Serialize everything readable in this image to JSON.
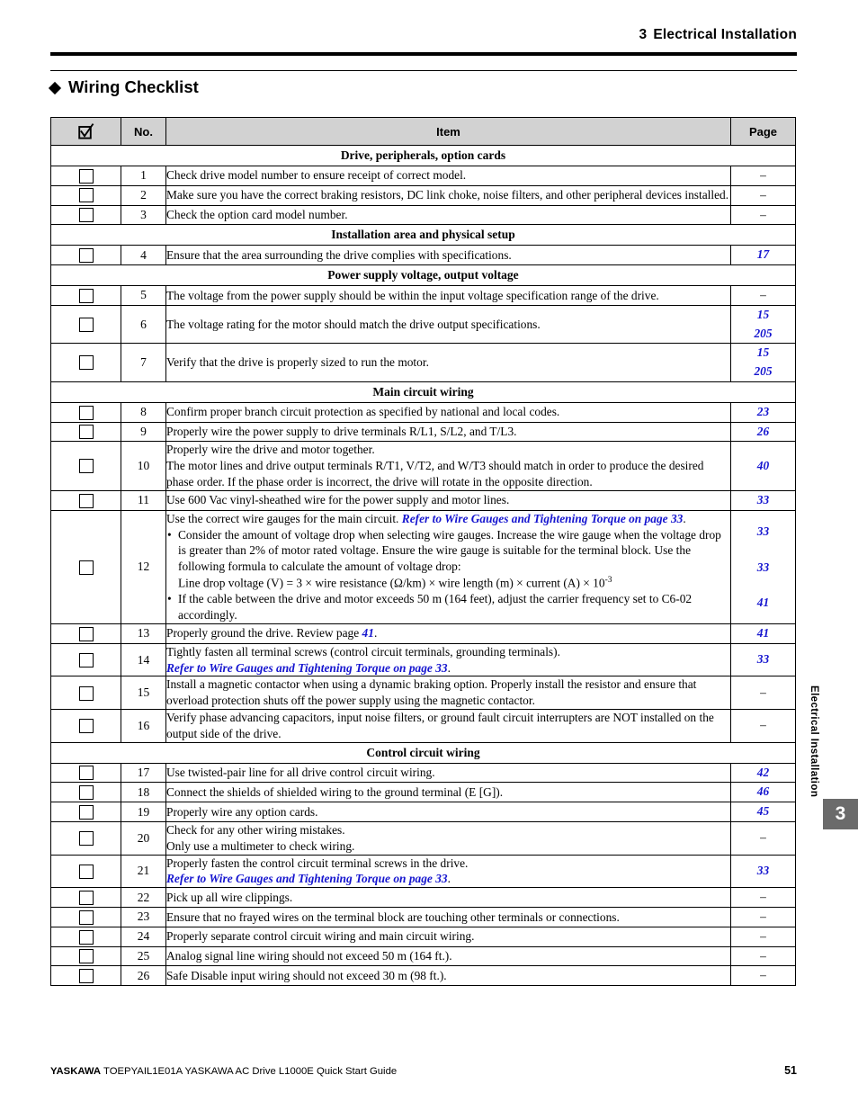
{
  "header": {
    "chapter_number": "3",
    "chapter_title": "Electrical Installation"
  },
  "section": {
    "title": "Wiring Checklist",
    "bullet_icon": "diamond-icon"
  },
  "table": {
    "columns": {
      "check": "check-box-icon",
      "no": "No.",
      "item": "Item",
      "page": "Page"
    },
    "sections": [
      {
        "heading": "Drive, peripherals, option cards",
        "rows": [
          {
            "no": "1",
            "item": "Check drive model number to ensure receipt of correct model.",
            "pages": [
              "–"
            ]
          },
          {
            "no": "2",
            "item": "Make sure you have the correct braking resistors, DC link choke, noise filters, and other peripheral devices installed.",
            "pages": [
              "–"
            ]
          },
          {
            "no": "3",
            "item": "Check the option card model number.",
            "pages": [
              "–"
            ]
          }
        ]
      },
      {
        "heading": "Installation area and physical setup",
        "rows": [
          {
            "no": "4",
            "item": "Ensure that the area surrounding the drive complies with specifications.",
            "pages": [
              "17"
            ]
          }
        ]
      },
      {
        "heading": "Power supply voltage, output voltage",
        "rows": [
          {
            "no": "5",
            "item": "The voltage from the power supply should be within the input voltage specification range of the drive.",
            "pages": [
              "–"
            ]
          },
          {
            "no": "6",
            "item": "The voltage rating for the motor should match the drive output specifications.",
            "pages": [
              "15",
              "205"
            ]
          },
          {
            "no": "7",
            "item": "Verify that the drive is properly sized to run the motor.",
            "pages": [
              "15",
              "205"
            ]
          }
        ]
      },
      {
        "heading": "Main circuit wiring",
        "rows": [
          {
            "no": "8",
            "item": "Confirm proper branch circuit protection as specified by national and local codes.",
            "pages": [
              "23"
            ]
          },
          {
            "no": "9",
            "item": "Properly wire the power supply to drive terminals R/L1, S/L2, and T/L3.",
            "pages": [
              "26"
            ]
          },
          {
            "no": "10",
            "item_lines": [
              "Properly wire the drive and motor together.",
              "The motor lines and drive output terminals R/T1, V/T2, and W/T3 should match in order to produce the desired phase order. If the phase order is incorrect, the drive will rotate in the opposite direction."
            ],
            "pages": [
              "40"
            ]
          },
          {
            "no": "11",
            "item": "Use 600 Vac vinyl-sheathed wire for the power supply and motor lines.",
            "pages": [
              "33"
            ]
          },
          {
            "no": "12",
            "lead_text": "Use the correct wire gauges for the main circuit. ",
            "lead_xref": "Refer to Wire Gauges and Tightening Torque on page 33",
            "lead_tail": ".",
            "bullet_1": "Consider the amount of voltage drop when selecting wire gauges. Increase the wire gauge when the voltage drop is greater than 2% of motor rated voltage. Ensure the wire gauge is suitable for the terminal block. Use the following formula to calculate the amount of voltage drop:",
            "formula_main": "Line drop voltage (V) = 3 × wire resistance (Ω/km) × wire length (m) × current (A) × 10",
            "formula_exp": "-3",
            "bullet_2": "If the cable between the drive and motor exceeds 50 m (164 feet), adjust the carrier frequency set to C6-02 accordingly.",
            "pages": [
              "33",
              "33",
              "41"
            ]
          },
          {
            "no": "13",
            "pre_text": "Properly ground the drive. Review page ",
            "inline_xref": "41",
            "post_text": ".",
            "pages": [
              "41"
            ]
          },
          {
            "no": "14",
            "line1": "Tightly fasten all terminal screws (control circuit terminals, grounding terminals).",
            "xref2": "Refer to Wire Gauges and Tightening Torque on page 33",
            "xref2_tail": ".",
            "pages": [
              "33"
            ]
          },
          {
            "no": "15",
            "item": "Install a magnetic contactor when using a dynamic braking option. Properly install the resistor and ensure that overload protection shuts off the power supply using the magnetic contactor.",
            "pages": [
              "–"
            ]
          },
          {
            "no": "16",
            "item": "Verify phase advancing capacitors, input noise filters, or ground fault circuit interrupters are NOT installed on the output side of the drive.",
            "pages": [
              "–"
            ]
          }
        ]
      },
      {
        "heading": "Control circuit wiring",
        "rows": [
          {
            "no": "17",
            "item": "Use twisted-pair line for all drive control circuit wiring.",
            "pages": [
              "42"
            ]
          },
          {
            "no": "18",
            "item": "Connect the shields of shielded wiring to the ground terminal (E [G]).",
            "pages": [
              "46"
            ]
          },
          {
            "no": "19",
            "item": "Properly wire any option cards.",
            "pages": [
              "45"
            ]
          },
          {
            "no": "20",
            "item_lines": [
              "Check for any other wiring mistakes.",
              "Only use a multimeter to check wiring."
            ],
            "pages": [
              "–"
            ]
          },
          {
            "no": "21",
            "line1": "Properly fasten the control circuit terminal screws in the drive.",
            "xref2": "Refer to Wire Gauges and Tightening Torque on page 33",
            "xref2_tail": ".",
            "pages": [
              "33"
            ]
          },
          {
            "no": "22",
            "item": "Pick up all wire clippings.",
            "pages": [
              "–"
            ]
          },
          {
            "no": "23",
            "item": "Ensure that no frayed wires on the terminal block are touching other terminals or connections.",
            "pages": [
              "–"
            ]
          },
          {
            "no": "24",
            "item": "Properly separate control circuit wiring and main circuit wiring.",
            "pages": [
              "–"
            ]
          },
          {
            "no": "25",
            "item": "Analog signal line wiring should not exceed 50 m (164 ft.).",
            "pages": [
              "–"
            ]
          },
          {
            "no": "26",
            "item": "Safe Disable input wiring should not exceed 30 m (98 ft.).",
            "pages": [
              "–"
            ]
          }
        ]
      }
    ]
  },
  "side_tab": {
    "label": "Electrical Installation",
    "number": "3"
  },
  "footer": {
    "brand": "YASKAWA",
    "doc_info": "TOEPYAIL1E01A YASKAWA AC Drive L1000E Quick Start Guide",
    "page_number": "51"
  },
  "colors": {
    "xref_blue": "#1515cf",
    "header_gray": "#d2d2d2",
    "tab_gray": "#6b6b6b"
  }
}
